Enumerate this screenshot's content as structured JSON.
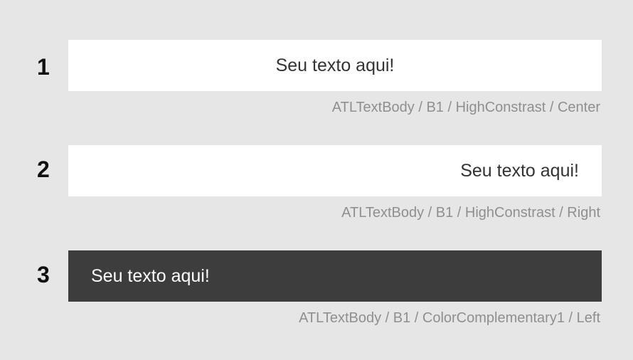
{
  "examples": [
    {
      "number": "1",
      "text": "Seu texto aqui!",
      "caption": "ATLTextBody / B1 / HighConstrast / Center"
    },
    {
      "number": "2",
      "text": "Seu texto aqui!",
      "caption": "ATLTextBody / B1 / HighConstrast / Right"
    },
    {
      "number": "3",
      "text": "Seu texto aqui!",
      "caption": "ATLTextBody / B1 / ColorComplementary1 / Left"
    }
  ],
  "colors": {
    "light_bg": "#ffffff",
    "dark_bg": "#3d3d3d",
    "light_text": "#333333",
    "dark_text": "#ffffff"
  }
}
